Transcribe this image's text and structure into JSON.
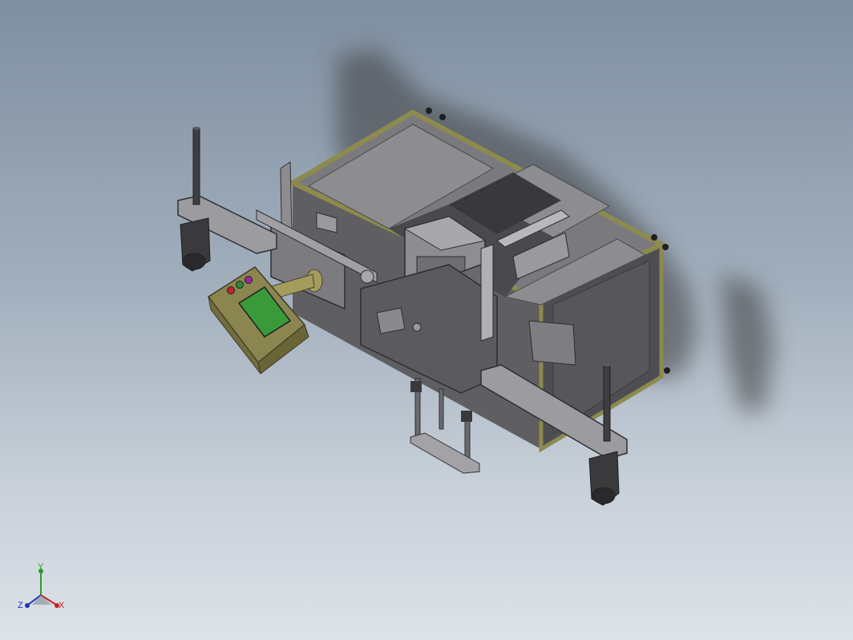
{
  "viewport": {
    "background_top": "#7f8fa1",
    "background_bottom": "#dde2e8"
  },
  "model": {
    "frame_accent_color": "#8c8a4e",
    "panel_color": "#6d6d70",
    "hmi_screen_color": "#3a9a3a",
    "hmi_button_colors": [
      "#c0282a",
      "#2a8a3a",
      "#9a2a9a"
    ]
  },
  "triad": {
    "x_label": "X",
    "y_label": "Y",
    "z_label": "Z",
    "x_color": "#c22222",
    "y_color": "#2d9a2d",
    "z_color": "#2433b8"
  }
}
